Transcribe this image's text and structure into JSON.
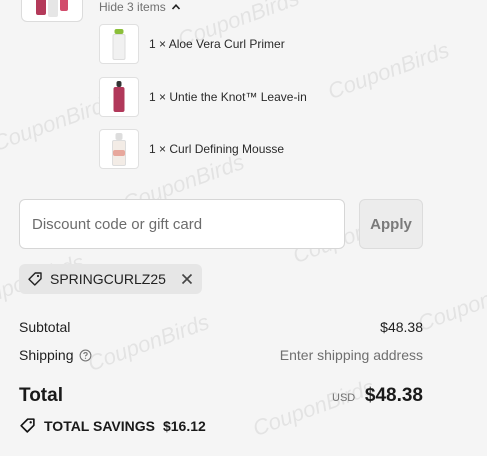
{
  "order_summary": {
    "toggle_label": "Hide 3 items",
    "items": [
      {
        "quantity_label": "1 ×",
        "name": "Aloe Vera Curl Primer"
      },
      {
        "quantity_label": "1 ×",
        "name": "Untie the Knot™ Leave-in"
      },
      {
        "quantity_label": "1 ×",
        "name": "Curl Defining Mousse"
      }
    ]
  },
  "discount": {
    "placeholder": "Discount code or gift card",
    "apply_label": "Apply",
    "applied_code": "SPRINGCURLZ25"
  },
  "totals": {
    "subtotal_label": "Subtotal",
    "subtotal_value": "$48.38",
    "shipping_label": "Shipping",
    "shipping_value": "Enter shipping address",
    "total_label": "Total",
    "currency": "USD",
    "total_value": "$48.38",
    "savings_label": "TOTAL SAVINGS",
    "savings_value": "$16.12"
  },
  "watermark": "CouponBirds",
  "icons": {
    "chevron": "chevron-up-icon",
    "help": "help-circle-icon",
    "tag": "tag-icon",
    "close": "close-icon"
  }
}
